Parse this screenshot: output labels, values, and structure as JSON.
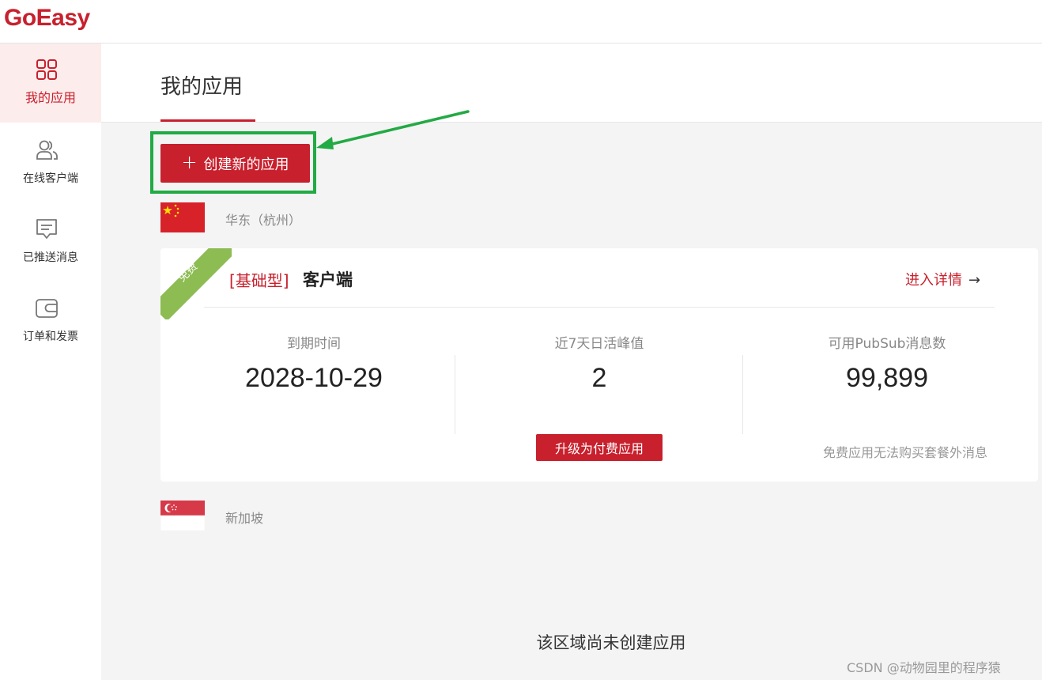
{
  "app": {
    "logo": "GoEasy"
  },
  "sidebar": {
    "items": [
      {
        "label": "我的应用",
        "icon": "grid-icon",
        "active": true
      },
      {
        "label": "在线客户端",
        "icon": "users-icon",
        "active": false
      },
      {
        "label": "已推送消息",
        "icon": "message-icon",
        "active": false
      },
      {
        "label": "订单和发票",
        "icon": "wallet-icon",
        "active": false
      }
    ]
  },
  "main": {
    "title": "我的应用",
    "create_button": "创建新的应用",
    "regions": [
      {
        "name": "华东（杭州）",
        "flag": "china-flag",
        "apps": [
          {
            "badge": "免费",
            "type": "[基础型]",
            "name": "客户端",
            "detail_link": "进入详情",
            "stats": [
              {
                "label": "到期时间",
                "value": "2028-10-29"
              },
              {
                "label": "近7天日活峰值",
                "value": "2"
              },
              {
                "label": "可用PubSub消息数",
                "value": "99,899"
              }
            ],
            "upgrade_button": "升级为付费应用",
            "note": "免费应用无法购买套餐外消息"
          }
        ]
      },
      {
        "name": "新加坡",
        "flag": "singapore-flag",
        "empty_text": "该区域尚未创建应用"
      }
    ]
  },
  "watermark": "CSDN @动物园里的程序猿",
  "colors": {
    "brand": "#c8202d",
    "highlight": "#22aa44",
    "badge": "#8cbc52"
  }
}
